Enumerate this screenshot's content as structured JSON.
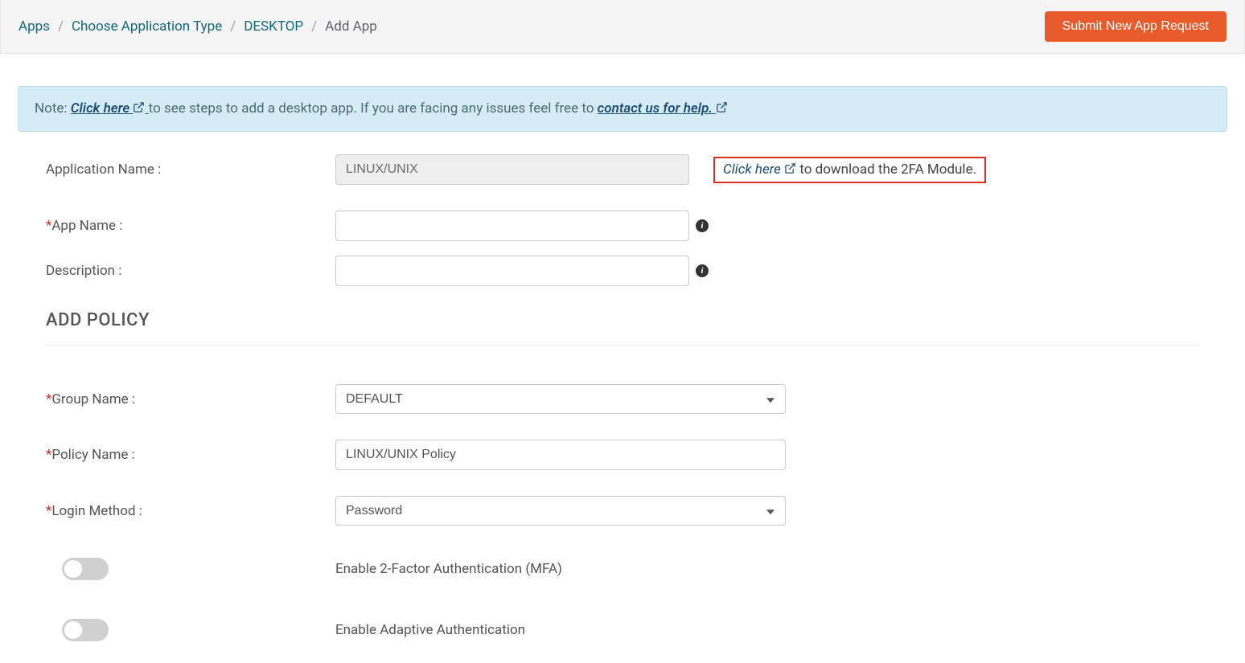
{
  "breadcrumb": {
    "apps": "Apps",
    "choose": "Choose Application Type",
    "desktop": "DESKTOP",
    "current": "Add App"
  },
  "header": {
    "submit_btn": "Submit New App Request"
  },
  "note": {
    "prefix": "Note: ",
    "link1": "Click here",
    "mid": " to see steps to add a desktop app. If you are facing any issues feel free to ",
    "link2": "contact us for help."
  },
  "form": {
    "application_name_label": "Application Name :",
    "application_name_value": "LINUX/UNIX",
    "download_link": "Click here",
    "download_suffix": " to download the 2FA Module.",
    "app_name_label": "App Name :",
    "app_name_value": "",
    "description_label": "Description :",
    "description_value": "",
    "section_heading": "ADD POLICY",
    "group_name_label": "Group Name :",
    "group_name_value": "DEFAULT",
    "policy_name_label": "Policy Name :",
    "policy_name_value": "LINUX/UNIX Policy",
    "login_method_label": "Login Method :",
    "login_method_value": "Password",
    "toggle_mfa_label": "Enable 2-Factor Authentication (MFA)",
    "toggle_adaptive_label": "Enable Adaptive Authentication"
  }
}
